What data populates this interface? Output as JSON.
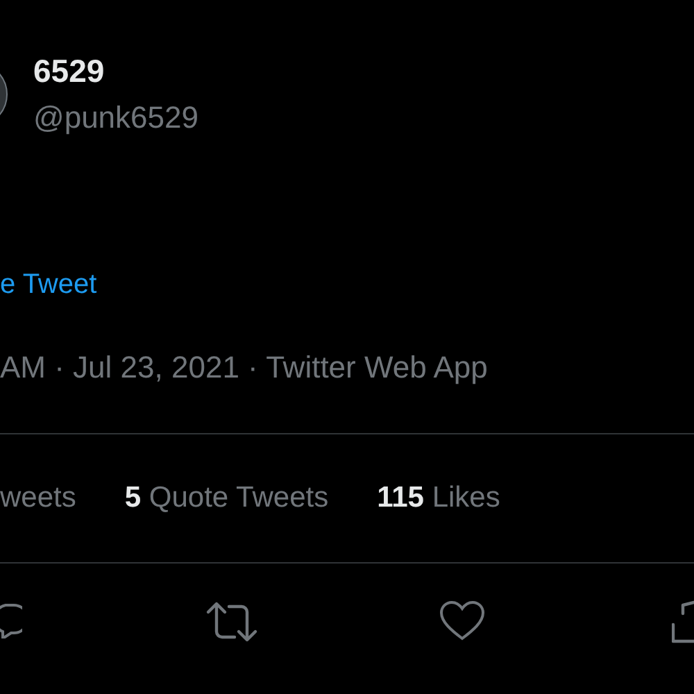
{
  "author": {
    "name": "6529",
    "handle": "@punk6529"
  },
  "translate_link": "e Tweet",
  "timestamp": "AM · Jul 23, 2021 · Twitter Web App",
  "stats": [
    {
      "label": "weets"
    },
    {
      "count": "5",
      "label": "Quote Tweets"
    },
    {
      "count": "115",
      "label": "Likes"
    }
  ]
}
